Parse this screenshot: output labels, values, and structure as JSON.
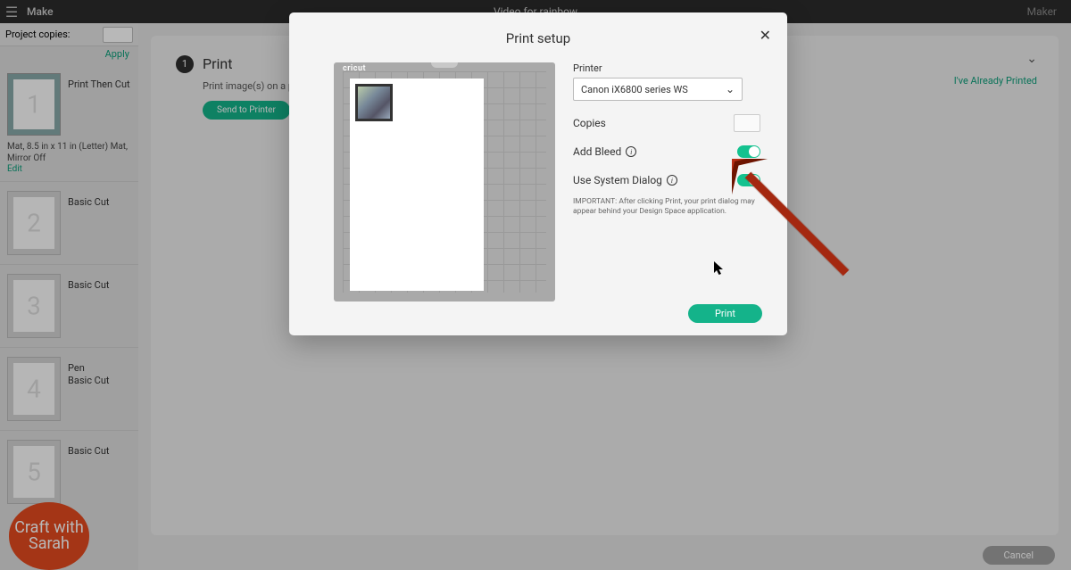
{
  "topbar": {
    "menu_label": "Make",
    "doc_title": "Video for rainbow",
    "machine": "Maker"
  },
  "sidebar": {
    "project_copies_label": "Project copies:",
    "apply_label": "Apply",
    "mat_info_line": "Mat, 8.5 in x 11 in (Letter) Mat, Mirror Off",
    "edit_label": "Edit",
    "items": [
      {
        "num": "1",
        "label": "Print Then Cut"
      },
      {
        "num": "2",
        "label": "Basic Cut"
      },
      {
        "num": "3",
        "label": "Basic Cut"
      },
      {
        "num": "4",
        "label_line1": "Pen",
        "label_line2": "Basic Cut"
      },
      {
        "num": "5",
        "label": "Basic Cut"
      }
    ]
  },
  "bgpanel": {
    "step_num": "1",
    "step_title": "Print",
    "subtitle": "Print image(s) on a printer of",
    "send_label": "Send to Printer",
    "already_label": "I've Already Printed",
    "cancel_label": "Cancel"
  },
  "modal": {
    "title": "Print setup",
    "mat_brand": "cricut",
    "printer_label": "Printer",
    "printer_value": "Canon iX6800 series WS",
    "copies_label": "Copies",
    "bleed_label": "Add Bleed",
    "sysdlg_label": "Use System Dialog",
    "sysdlg_hint": "IMPORTANT: After clicking Print, your print dialog may appear behind your Design Space application.",
    "print_button": "Print"
  },
  "logo": {
    "text": "Craft with Sarah"
  }
}
